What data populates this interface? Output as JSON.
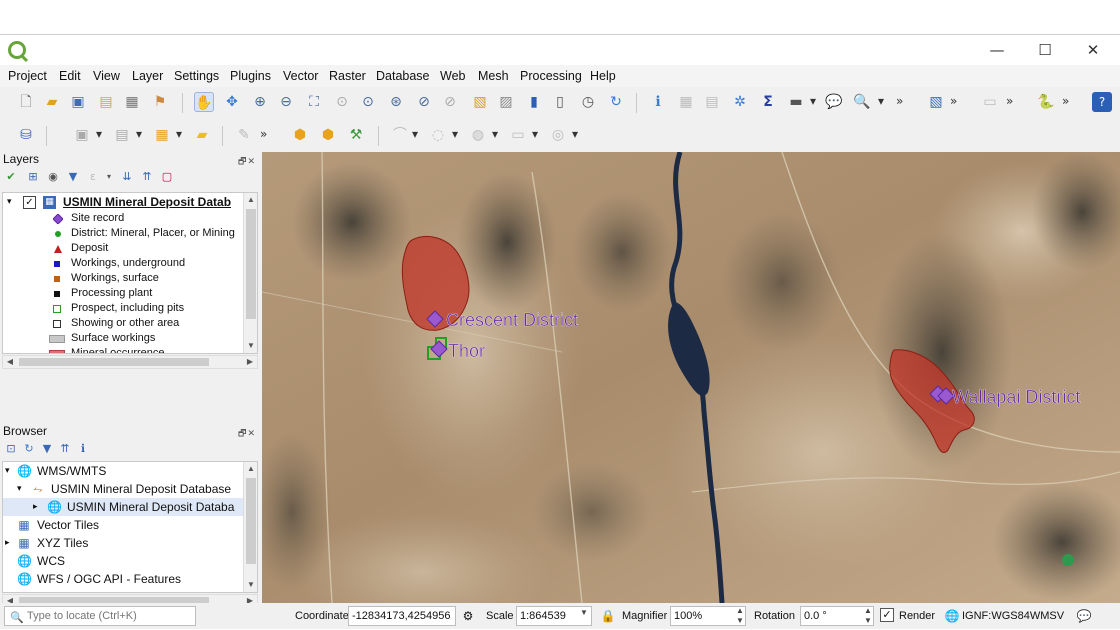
{
  "window": {
    "minimize": "—",
    "maximize": "☐",
    "close": "✕"
  },
  "menu": [
    "Project",
    "Edit",
    "View",
    "Layer",
    "Settings",
    "Plugins",
    "Vector",
    "Raster",
    "Database",
    "Web",
    "Mesh",
    "Processing",
    "Help"
  ],
  "layers_panel": {
    "title": "Layers",
    "layer_name": "USMIN Mineral Deposit Datab",
    "legend": [
      {
        "label": "Site record",
        "color": "#8a4ad0",
        "shape": "diamond"
      },
      {
        "label": "District: Mineral, Placer, or Mining",
        "color": "#22a022",
        "shape": "circle"
      },
      {
        "label": "Deposit",
        "color": "#c02020",
        "shape": "triangle"
      },
      {
        "label": "Workings, underground",
        "color": "#1a1ac0",
        "shape": "square"
      },
      {
        "label": "Workings, surface",
        "color": "#c06010",
        "shape": "square"
      },
      {
        "label": "Processing plant",
        "color": "#111111",
        "shape": "square"
      },
      {
        "label": "Prospect, including pits",
        "color": "#22a022",
        "shape": "hollow-square"
      },
      {
        "label": "Showing or other area",
        "color": "#333333",
        "shape": "hollow-square"
      },
      {
        "label": "Surface workings",
        "color": "#c8c8c8",
        "shape": "rect"
      },
      {
        "label": "Mineral occurrence",
        "color": "#e07070",
        "shape": "rect"
      }
    ]
  },
  "browser_panel": {
    "title": "Browser",
    "items": [
      {
        "label": "WMS/WMTS",
        "icon": "globe-icon",
        "level": 0,
        "expanded": true
      },
      {
        "label": "USMIN Mineral Deposit Database",
        "icon": "wms-connection-icon",
        "level": 1,
        "expanded": true
      },
      {
        "label": "USMIN Mineral Deposit Databa",
        "icon": "globe-icon",
        "level": 2,
        "expanded": false,
        "selected": true
      },
      {
        "label": "Vector Tiles",
        "icon": "grid-icon",
        "level": 0,
        "expanded": null
      },
      {
        "label": "XYZ Tiles",
        "icon": "grid-icon",
        "level": 0,
        "expanded": false
      },
      {
        "label": "WCS",
        "icon": "globe-icon",
        "level": 0,
        "expanded": null
      },
      {
        "label": "WFS / OGC API - Features",
        "icon": "globe-icon",
        "level": 0,
        "expanded": null
      }
    ]
  },
  "map": {
    "labels": {
      "crescent": "Crescent District",
      "thor": "Thor",
      "walapai": "Wallapai District"
    },
    "colors": {
      "district_fill": "#c0392b",
      "site_marker": "#9b59d0",
      "label_color": "#6a2aa0",
      "water": "#1c2a44"
    }
  },
  "statusbar": {
    "locator_placeholder": "Type to locate (Ctrl+K)",
    "coordinate_label": "Coordinate",
    "coordinate_value": "-12834173,4254956",
    "scale_label": "Scale",
    "scale_value": "1:864539",
    "magnifier_label": "Magnifier",
    "magnifier_value": "100%",
    "rotation_label": "Rotation",
    "rotation_value": "0.0 °",
    "render_label": "Render",
    "render_checked": true,
    "crs": "IGNF:WGS84WMSV"
  }
}
